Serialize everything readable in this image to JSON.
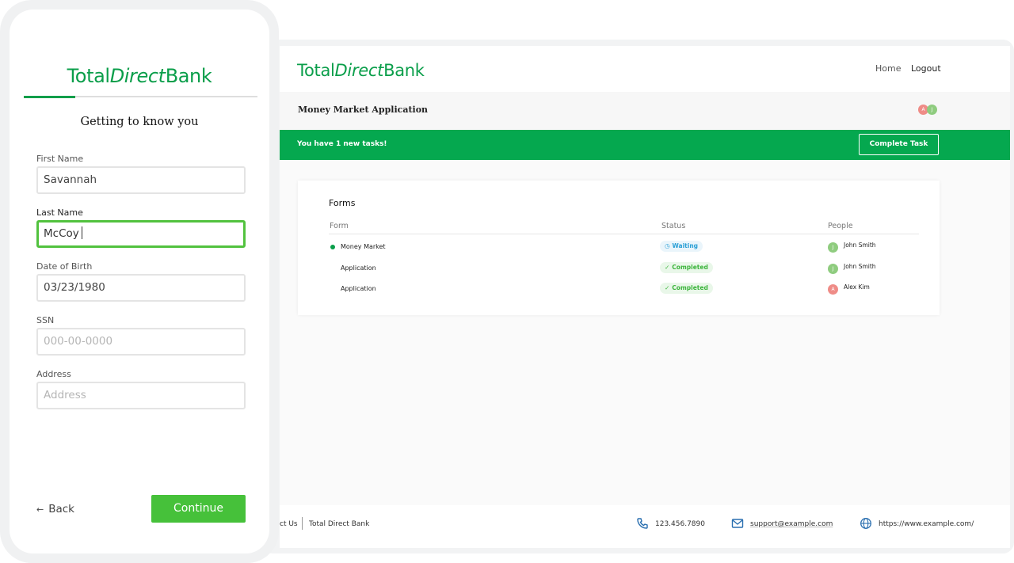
{
  "brand": {
    "part1": "Total",
    "part2": "Direct",
    "part3": "Bank",
    "color": "#0a9e4a"
  },
  "desktop": {
    "nav": {
      "home": "Home",
      "logout": "Logout"
    },
    "subtitle": "Money Market Application",
    "avatars": [
      "A",
      "J"
    ],
    "banner": {
      "text": "You have 1 new tasks!",
      "button": "Complete Task",
      "color": "#05a84f"
    },
    "forms": {
      "title": "Forms",
      "columns": {
        "form": "Form",
        "status": "Status",
        "people": "People"
      },
      "rows": [
        {
          "form": "Money Market",
          "status": "Waiting",
          "status_icon": "clock-icon",
          "person_initial": "J",
          "person": "John Smith"
        },
        {
          "form": "Application",
          "status": "Completed",
          "status_icon": "check-icon",
          "person_initial": "J",
          "person": "John Smith"
        },
        {
          "form": "Application",
          "status": "Completed",
          "status_icon": "check-icon",
          "person_initial": "A",
          "person": "Alex Kim"
        }
      ]
    },
    "footer": {
      "contact": "ct Us",
      "company": "Total Direct Bank",
      "phone": "123.456.7890",
      "email": "support@example.com",
      "website": "https://www.example.com/"
    }
  },
  "phone": {
    "progress": 0.22,
    "heading": "Getting to know you",
    "fields": {
      "first_name": {
        "label": "First Name",
        "value": "Savannah"
      },
      "last_name": {
        "label": "Last Name",
        "value": "McCoy"
      },
      "dob": {
        "label": "Date of Birth",
        "value": "03/23/1980"
      },
      "ssn": {
        "label": "SSN",
        "placeholder": "000-00-0000"
      },
      "address": {
        "label": "Address",
        "placeholder": "Address"
      }
    },
    "back": "Back",
    "back_arrow": "←",
    "continue": "Continue",
    "continue_color": "#46c13a"
  }
}
